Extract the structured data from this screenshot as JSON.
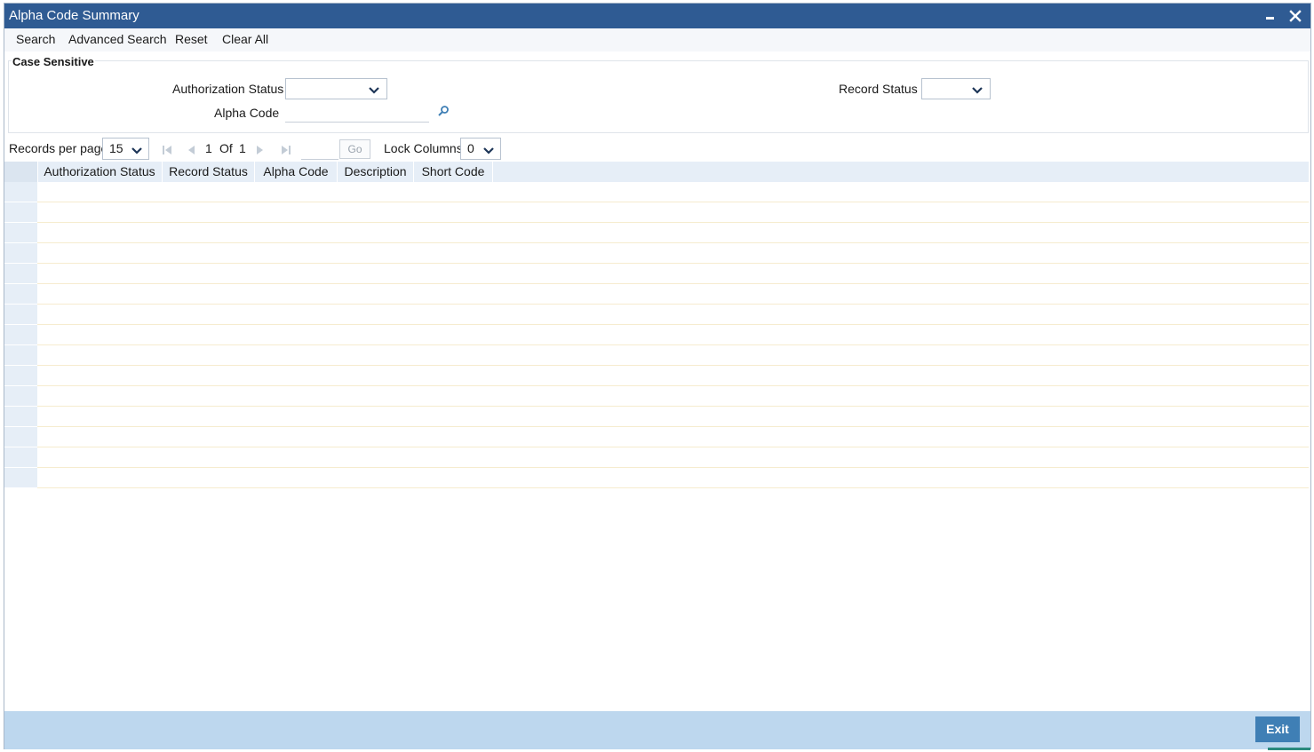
{
  "window": {
    "title": "Alpha Code Summary"
  },
  "menu": {
    "search": "Search",
    "advanced_search": "Advanced Search",
    "reset": "Reset",
    "clear_all": "Clear All"
  },
  "criteria": {
    "legend": "Case Sensitive",
    "authorization_status_label": "Authorization Status",
    "authorization_status_value": "",
    "record_status_label": "Record Status",
    "record_status_value": "",
    "alpha_code_label": "Alpha Code",
    "alpha_code_value": ""
  },
  "pager": {
    "records_per_page_label": "Records per page",
    "records_per_page": "15",
    "current_page": "1",
    "of_label": "Of",
    "total_pages": "1",
    "go_label": "Go",
    "lock_columns_label": "Lock Columns",
    "lock_columns": "0"
  },
  "grid": {
    "columns": [
      "Authorization Status",
      "Record Status",
      "Alpha Code",
      "Description",
      "Short Code"
    ],
    "row_count": 15
  },
  "footer": {
    "exit": "Exit"
  },
  "colors": {
    "titlebar": "#2f5b93",
    "footer": "#bdd7ee",
    "exit_button": "#3f7fb5"
  }
}
